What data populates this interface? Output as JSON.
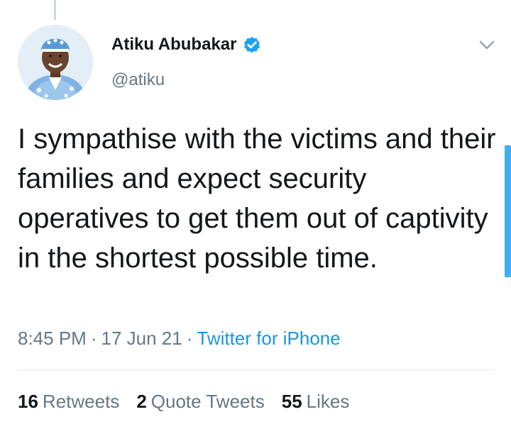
{
  "author": {
    "display_name": "Atiku Abubakar",
    "handle": "@atiku",
    "verified_icon": "verified-badge-icon"
  },
  "tweet": {
    "text": "I sympathise with the victims and their families and expect security operatives to get them out of captivity in the shortest possible time.",
    "time": "8:45 PM",
    "date": "17 Jun 21",
    "separator": "·",
    "source": "Twitter for iPhone"
  },
  "stats": {
    "retweets_count": "16",
    "retweets_label": "Retweets",
    "quote_tweets_count": "2",
    "quote_tweets_label": "Quote Tweets",
    "likes_count": "55",
    "likes_label": "Likes"
  },
  "colors": {
    "accent": "#1da1f2",
    "link": "#1b95e0",
    "muted_text": "#657786",
    "primary_text": "#14171a",
    "divider": "#e1e8ed"
  },
  "icons": {
    "menu": "chevron-down-icon",
    "avatar": "profile-avatar"
  }
}
